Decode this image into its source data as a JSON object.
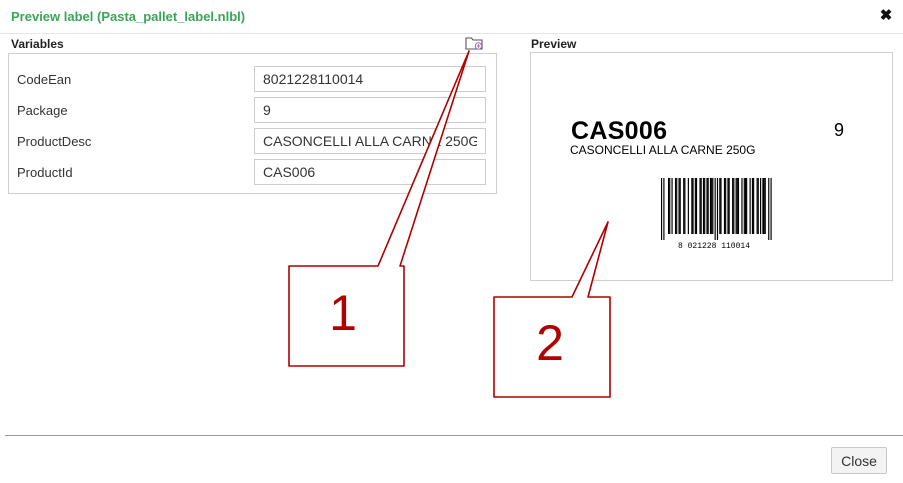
{
  "dialog": {
    "title": "Preview label (Pasta_pallet_label.nlbl)",
    "close_icon_glyph": "✖"
  },
  "variables": {
    "heading": "Variables",
    "rows": [
      {
        "name": "CodeEan",
        "value": "8021228110014"
      },
      {
        "name": "Package",
        "value": "9"
      },
      {
        "name": "ProductDesc",
        "value": "CASONCELLI ALLA CARNE 250G"
      },
      {
        "name": "ProductId",
        "value": "CAS006"
      }
    ],
    "folder_icon": "folder-icon"
  },
  "preview": {
    "heading": "Preview",
    "product_id": "CAS006",
    "product_desc": "CASONCELLI ALLA CARNE 250G",
    "package": "9",
    "barcode_number": "8021228110014",
    "barcode_digits_display": "8 021228 110014"
  },
  "callouts": {
    "first": "1",
    "second": "2",
    "color": "#b00000"
  },
  "footer": {
    "close_label": "Close"
  }
}
